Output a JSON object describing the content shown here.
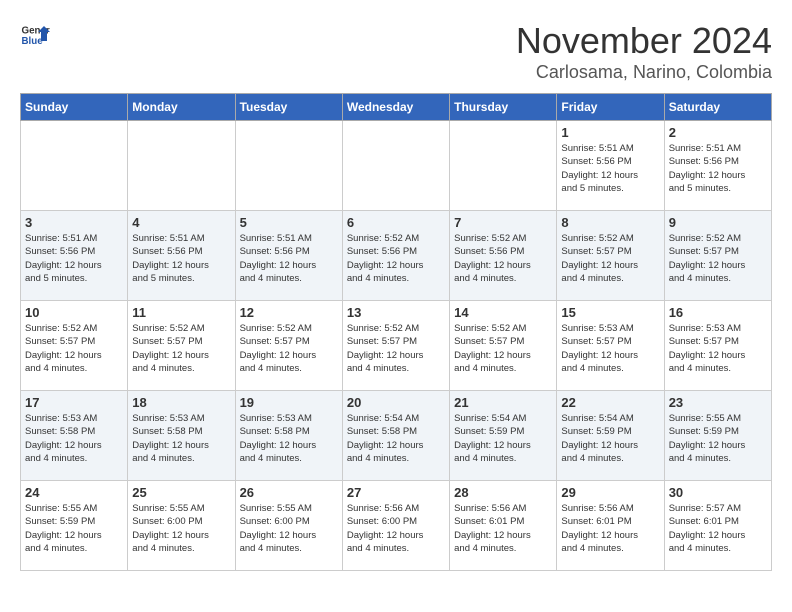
{
  "header": {
    "logo_general": "General",
    "logo_blue": "Blue",
    "month_title": "November 2024",
    "location": "Carlosama, Narino, Colombia"
  },
  "weekdays": [
    "Sunday",
    "Monday",
    "Tuesday",
    "Wednesday",
    "Thursday",
    "Friday",
    "Saturday"
  ],
  "weeks": [
    {
      "days": [
        {
          "num": "",
          "info": ""
        },
        {
          "num": "",
          "info": ""
        },
        {
          "num": "",
          "info": ""
        },
        {
          "num": "",
          "info": ""
        },
        {
          "num": "",
          "info": ""
        },
        {
          "num": "1",
          "info": "Sunrise: 5:51 AM\nSunset: 5:56 PM\nDaylight: 12 hours\nand 5 minutes."
        },
        {
          "num": "2",
          "info": "Sunrise: 5:51 AM\nSunset: 5:56 PM\nDaylight: 12 hours\nand 5 minutes."
        }
      ]
    },
    {
      "days": [
        {
          "num": "3",
          "info": "Sunrise: 5:51 AM\nSunset: 5:56 PM\nDaylight: 12 hours\nand 5 minutes."
        },
        {
          "num": "4",
          "info": "Sunrise: 5:51 AM\nSunset: 5:56 PM\nDaylight: 12 hours\nand 5 minutes."
        },
        {
          "num": "5",
          "info": "Sunrise: 5:51 AM\nSunset: 5:56 PM\nDaylight: 12 hours\nand 4 minutes."
        },
        {
          "num": "6",
          "info": "Sunrise: 5:52 AM\nSunset: 5:56 PM\nDaylight: 12 hours\nand 4 minutes."
        },
        {
          "num": "7",
          "info": "Sunrise: 5:52 AM\nSunset: 5:56 PM\nDaylight: 12 hours\nand 4 minutes."
        },
        {
          "num": "8",
          "info": "Sunrise: 5:52 AM\nSunset: 5:57 PM\nDaylight: 12 hours\nand 4 minutes."
        },
        {
          "num": "9",
          "info": "Sunrise: 5:52 AM\nSunset: 5:57 PM\nDaylight: 12 hours\nand 4 minutes."
        }
      ]
    },
    {
      "days": [
        {
          "num": "10",
          "info": "Sunrise: 5:52 AM\nSunset: 5:57 PM\nDaylight: 12 hours\nand 4 minutes."
        },
        {
          "num": "11",
          "info": "Sunrise: 5:52 AM\nSunset: 5:57 PM\nDaylight: 12 hours\nand 4 minutes."
        },
        {
          "num": "12",
          "info": "Sunrise: 5:52 AM\nSunset: 5:57 PM\nDaylight: 12 hours\nand 4 minutes."
        },
        {
          "num": "13",
          "info": "Sunrise: 5:52 AM\nSunset: 5:57 PM\nDaylight: 12 hours\nand 4 minutes."
        },
        {
          "num": "14",
          "info": "Sunrise: 5:52 AM\nSunset: 5:57 PM\nDaylight: 12 hours\nand 4 minutes."
        },
        {
          "num": "15",
          "info": "Sunrise: 5:53 AM\nSunset: 5:57 PM\nDaylight: 12 hours\nand 4 minutes."
        },
        {
          "num": "16",
          "info": "Sunrise: 5:53 AM\nSunset: 5:57 PM\nDaylight: 12 hours\nand 4 minutes."
        }
      ]
    },
    {
      "days": [
        {
          "num": "17",
          "info": "Sunrise: 5:53 AM\nSunset: 5:58 PM\nDaylight: 12 hours\nand 4 minutes."
        },
        {
          "num": "18",
          "info": "Sunrise: 5:53 AM\nSunset: 5:58 PM\nDaylight: 12 hours\nand 4 minutes."
        },
        {
          "num": "19",
          "info": "Sunrise: 5:53 AM\nSunset: 5:58 PM\nDaylight: 12 hours\nand 4 minutes."
        },
        {
          "num": "20",
          "info": "Sunrise: 5:54 AM\nSunset: 5:58 PM\nDaylight: 12 hours\nand 4 minutes."
        },
        {
          "num": "21",
          "info": "Sunrise: 5:54 AM\nSunset: 5:59 PM\nDaylight: 12 hours\nand 4 minutes."
        },
        {
          "num": "22",
          "info": "Sunrise: 5:54 AM\nSunset: 5:59 PM\nDaylight: 12 hours\nand 4 minutes."
        },
        {
          "num": "23",
          "info": "Sunrise: 5:55 AM\nSunset: 5:59 PM\nDaylight: 12 hours\nand 4 minutes."
        }
      ]
    },
    {
      "days": [
        {
          "num": "24",
          "info": "Sunrise: 5:55 AM\nSunset: 5:59 PM\nDaylight: 12 hours\nand 4 minutes."
        },
        {
          "num": "25",
          "info": "Sunrise: 5:55 AM\nSunset: 6:00 PM\nDaylight: 12 hours\nand 4 minutes."
        },
        {
          "num": "26",
          "info": "Sunrise: 5:55 AM\nSunset: 6:00 PM\nDaylight: 12 hours\nand 4 minutes."
        },
        {
          "num": "27",
          "info": "Sunrise: 5:56 AM\nSunset: 6:00 PM\nDaylight: 12 hours\nand 4 minutes."
        },
        {
          "num": "28",
          "info": "Sunrise: 5:56 AM\nSunset: 6:01 PM\nDaylight: 12 hours\nand 4 minutes."
        },
        {
          "num": "29",
          "info": "Sunrise: 5:56 AM\nSunset: 6:01 PM\nDaylight: 12 hours\nand 4 minutes."
        },
        {
          "num": "30",
          "info": "Sunrise: 5:57 AM\nSunset: 6:01 PM\nDaylight: 12 hours\nand 4 minutes."
        }
      ]
    }
  ]
}
